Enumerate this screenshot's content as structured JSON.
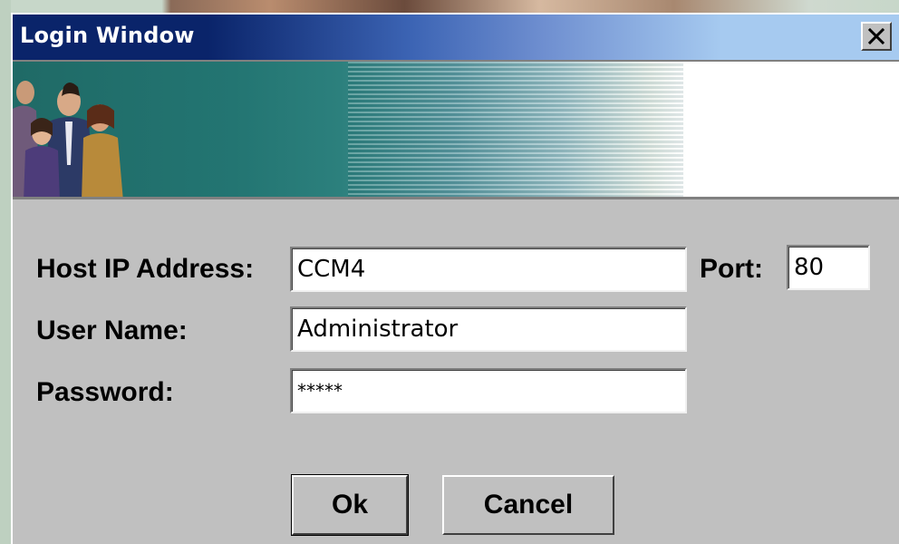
{
  "window": {
    "title": "Login Window",
    "close_label": "×"
  },
  "banner": {
    "image": "people-silhouettes-banner"
  },
  "form": {
    "host": {
      "label": "Host IP Address:",
      "value": "CCM4"
    },
    "port": {
      "label": "Port:",
      "value": "80"
    },
    "username": {
      "label": "User Name:",
      "value": "Administrator"
    },
    "password": {
      "label": "Password:",
      "value": "*****"
    }
  },
  "buttons": {
    "ok_label": "Ok",
    "cancel_label": "Cancel"
  },
  "colors": {
    "titlebar_start": "#0a246a",
    "titlebar_end": "#a6caf0",
    "window_bg": "#c0c0c0",
    "banner_teal": "#237572"
  },
  "icons": {
    "close": "close-icon"
  }
}
